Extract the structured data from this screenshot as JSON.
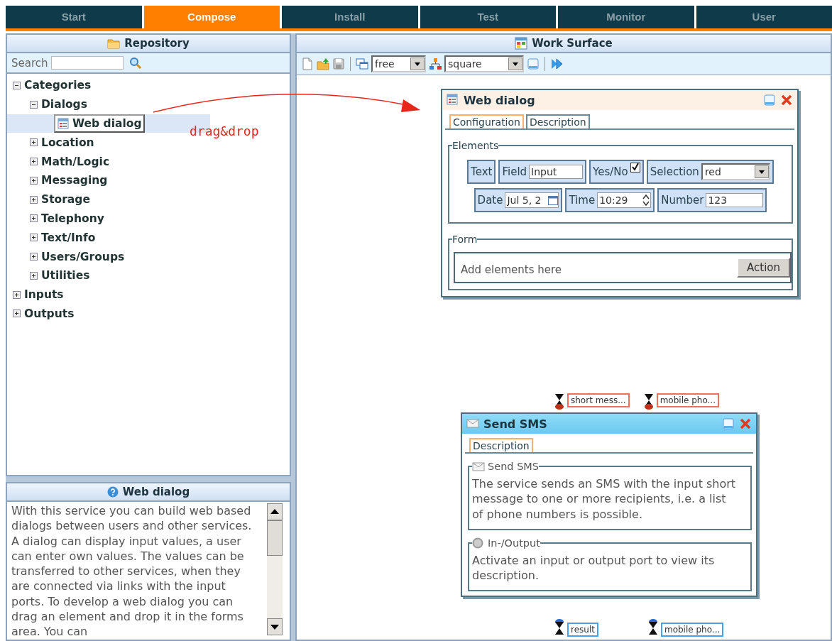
{
  "top_tabs": [
    {
      "label": "Start",
      "selected": false
    },
    {
      "label": "Compose",
      "selected": true
    },
    {
      "label": "Install",
      "selected": false
    },
    {
      "label": "Test",
      "selected": false
    },
    {
      "label": "Monitor",
      "selected": false
    },
    {
      "label": "User",
      "selected": false
    }
  ],
  "repository": {
    "title": "Repository",
    "search_label": "Search",
    "tree": [
      {
        "label": "Categories",
        "selected": false,
        "expanded": true,
        "children": [
          {
            "label": "Dialogs",
            "selected": false,
            "expanded": true,
            "children": [
              {
                "label": "Web dialog",
                "selected": true
              }
            ]
          },
          {
            "label": "Location",
            "selected": false,
            "expanded": false
          },
          {
            "label": "Math/Logic",
            "selected": false,
            "expanded": false
          },
          {
            "label": "Messaging",
            "selected": false,
            "expanded": false
          },
          {
            "label": "Storage",
            "selected": false,
            "expanded": false
          },
          {
            "label": "Telephony",
            "selected": false,
            "expanded": false
          },
          {
            "label": "Text/Info",
            "selected": false,
            "expanded": false
          },
          {
            "label": "Users/Groups",
            "selected": false,
            "expanded": false
          },
          {
            "label": "Utilities",
            "selected": false,
            "expanded": false
          }
        ]
      },
      {
        "label": "Inputs",
        "selected": false,
        "expanded": false
      },
      {
        "label": "Outputs",
        "selected": false,
        "expanded": false
      }
    ]
  },
  "help": {
    "title": "Web dialog",
    "text": "With this service you can build web based dialogs between users and other services. A dialog can display input values, a user can enter own values. The values can be transferred to other services, when they are connected via links with the input ports. To develop a web dialog you can drag an element and drop it in the forms area. You can"
  },
  "annotation": "drag&drop",
  "work_surface": {
    "title": "Work Surface",
    "layout_select": "free",
    "shape_select": "square"
  },
  "web_dialog_window": {
    "title": "Web dialog",
    "tabs": [
      {
        "label": "Configuration",
        "selected": true
      },
      {
        "label": "Description",
        "selected": false
      }
    ],
    "elements_legend": "Elements",
    "element_rows": [
      [
        {
          "kind": "text",
          "label": "Text"
        },
        {
          "kind": "field",
          "label": "Field",
          "value": "Input"
        },
        {
          "kind": "checkbox",
          "label": "Yes/No",
          "checked": true
        },
        {
          "kind": "select",
          "label": "Selection",
          "value": "red"
        }
      ],
      [
        {
          "kind": "date",
          "label": "Date",
          "value": "Jul 5, 2"
        },
        {
          "kind": "time",
          "label": "Time",
          "value": "10:29"
        },
        {
          "kind": "number",
          "label": "Number",
          "value": "123"
        }
      ]
    ],
    "form_legend": "Form",
    "form_hint": "Add elements here",
    "action": "Action"
  },
  "sms_window": {
    "title": "Send SMS",
    "tabs": [
      {
        "label": "Description",
        "selected": true
      }
    ],
    "sections": [
      {
        "kind": "envelope",
        "legend": "Send SMS",
        "text": "The service sends an SMS with the input short message to one or more recipients, i.e. a list of phone numbers is possible."
      },
      {
        "kind": "port",
        "legend": "In-/Output",
        "text": "Activate an input or output port to view its description."
      }
    ],
    "input_ports": [
      "short mess...",
      "mobile pho..."
    ],
    "output_ports": [
      "result",
      "mobile pho..."
    ]
  }
}
